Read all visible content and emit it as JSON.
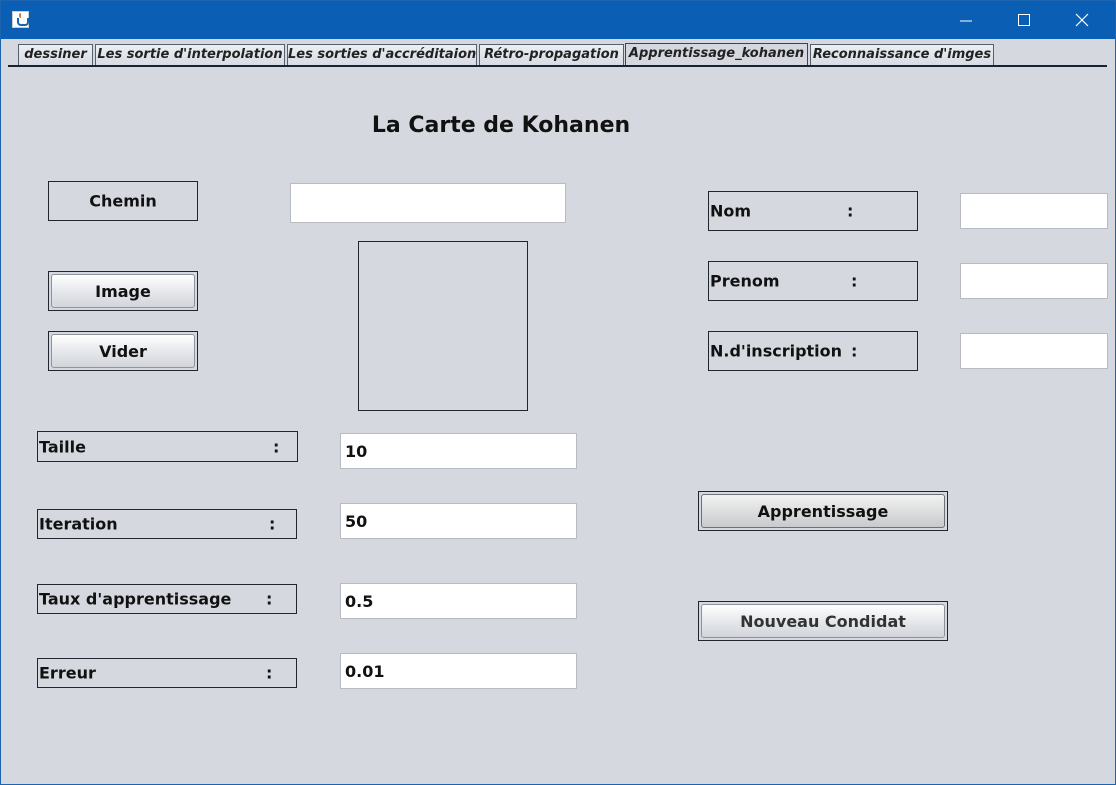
{
  "titlebar": {
    "app_icon": "java-cup-icon",
    "minimize_icon": "minimize-icon",
    "maximize_icon": "maximize-icon",
    "close_icon": "close-icon"
  },
  "tabs": [
    {
      "label": "dessiner",
      "active": false
    },
    {
      "label": "Les sortie d'interpolation",
      "active": false
    },
    {
      "label": "Les sorties d'accréditaion",
      "active": false
    },
    {
      "label": "Rétro-propagation",
      "active": false
    },
    {
      "label": "Apprentissage_kohanen",
      "active": true
    },
    {
      "label": "Reconnaissance d'imges",
      "active": false
    }
  ],
  "page": {
    "title": "La Carte de Kohanen"
  },
  "left": {
    "chemin_label": "Chemin",
    "chemin_value": "",
    "image_button": "Image",
    "vider_button": "Vider"
  },
  "params": {
    "taille": {
      "label": "Taille",
      "colon": ":",
      "value": "10"
    },
    "iteration": {
      "label": "Iteration",
      "colon": ":",
      "value": "50"
    },
    "taux": {
      "label": "Taux d'apprentissage",
      "colon": ":",
      "value": "0.5"
    },
    "erreur": {
      "label": "Erreur",
      "colon": ":",
      "value": "0.01"
    }
  },
  "candidate": {
    "nom": {
      "label": "Nom",
      "colon": ":",
      "value": ""
    },
    "prenom": {
      "label": "Prenom",
      "colon": ":",
      "value": ""
    },
    "inscription": {
      "label": "N.d'inscription",
      "colon": ":",
      "value": ""
    }
  },
  "actions": {
    "apprentissage_button": "Apprentissage",
    "nouveau_button": "Nouveau Condidat"
  }
}
